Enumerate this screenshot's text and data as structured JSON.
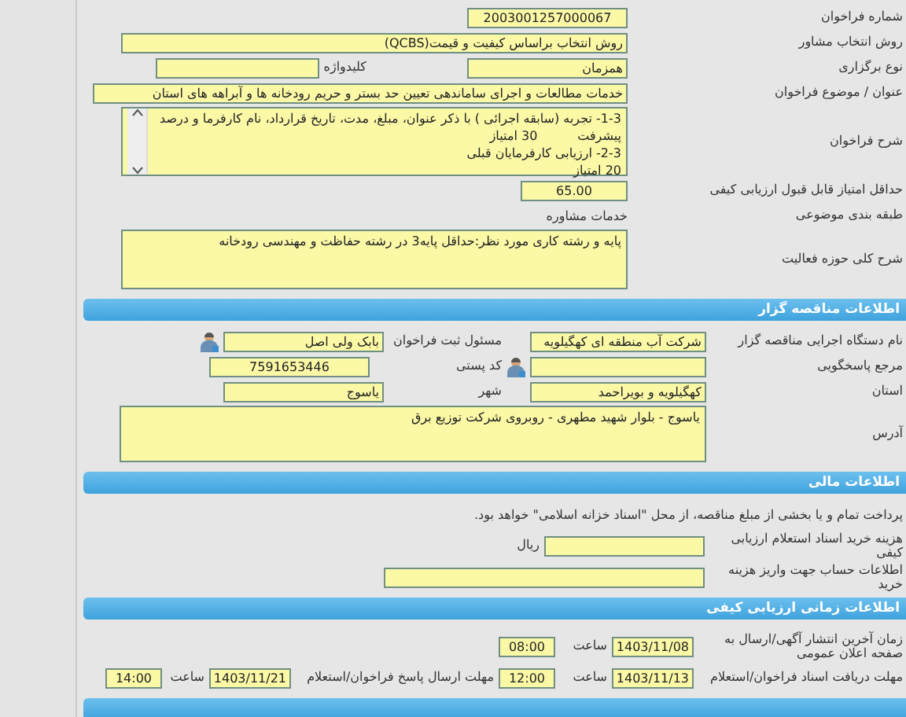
{
  "general": {
    "call_number": {
      "label": "شماره فراخوان",
      "value": "2003001257000067"
    },
    "consultant_method": {
      "label": "روش انتخاب مشاور",
      "value": "روش انتخاب براساس کیفیت و قیمت(QCBS)"
    },
    "holding_type": {
      "label": "نوع برگزاری",
      "value": "همزمان"
    },
    "keyword": {
      "label": "کلیدواژه"
    },
    "subject": {
      "label": "عنوان / موضوع فراخوان",
      "value": "خدمات مطالعات و اجرای ساماندهی تعیین حد بستر و حریم رودخانه ها و آبراهه های استان"
    },
    "description": {
      "label": "شرح فراخوان",
      "lines": [
        "1-3- تجربه (سابقه اجرائی ) با ذکر عنوان، مبلغ، مدت، تاریخ قرارداد، نام کارفرما و درصد",
        "پیشرفت          30 امتیاز",
        "2-3- ارزیابی کارفرمایان قبلی",
        "20 امتیاز"
      ]
    },
    "min_score": {
      "label": "حداقل امتیاز قابل قبول ارزیابی کیفی",
      "value": "65.00"
    },
    "category": {
      "label": "طبقه بندی موضوعی",
      "value": "خدمات مشاوره"
    },
    "activity": {
      "label": "شرح کلی حوزه فعالیت",
      "value": "پایه و رشته کاری مورد نظر:حداقل پایه3 در رشته حفاظت و مهندسی رودخانه"
    }
  },
  "tenderer": {
    "title": "اطلاعات مناقصه گزار",
    "organization": {
      "label": "نام دستگاه اجرایی مناقصه گزار",
      "value": "شرکت آب منطقه ای کهگیلویه"
    },
    "registrar": {
      "label": "مسئول ثبت فراخوان",
      "value": "بابک ولی اصل"
    },
    "responder": {
      "label": "مرجع پاسخگویی"
    },
    "postal_code": {
      "label": "کد پستی",
      "value": "7591653446"
    },
    "province": {
      "label": "استان",
      "value": "کهگیلویه و بویراحمد"
    },
    "city": {
      "label": "شهر",
      "value": "یاسوج"
    },
    "address": {
      "label": "آدرس",
      "value": "یاسوج - بلوار شهید مطهری - روبروی شرکت توزیع برق"
    }
  },
  "financial": {
    "title": "اطلاعات مالی",
    "note": "پرداخت تمام و یا بخشی از مبلغ مناقصه، از محل \"اسناد خزانه اسلامی\" خواهد بود.",
    "document_fee": {
      "label": "هزینه خرید اسناد استعلام ارزیابی کیفی",
      "unit": "ریال"
    },
    "account": {
      "label": "اطلاعات حساب جهت واریز هزینه خرید"
    }
  },
  "timing": {
    "title": "اطلاعات زمانی ارزیابی کیفی",
    "publish": {
      "label": "زمان آخرین انتشار آگهی/ارسال به صفحه اعلان عمومی",
      "date": "1403/11/08",
      "time_label": "ساعت",
      "time": "08:00"
    },
    "receive_deadline": {
      "label": "مهلت دریافت اسناد فراخوان/استعلام",
      "date": "1403/11/13",
      "time_label": "ساعت",
      "time": "12:00"
    },
    "response_deadline": {
      "label": "مهلت ارسال پاسخ فراخوان/استعلام",
      "date": "1403/11/21",
      "time_label": "ساعت",
      "time": "14:00"
    }
  }
}
